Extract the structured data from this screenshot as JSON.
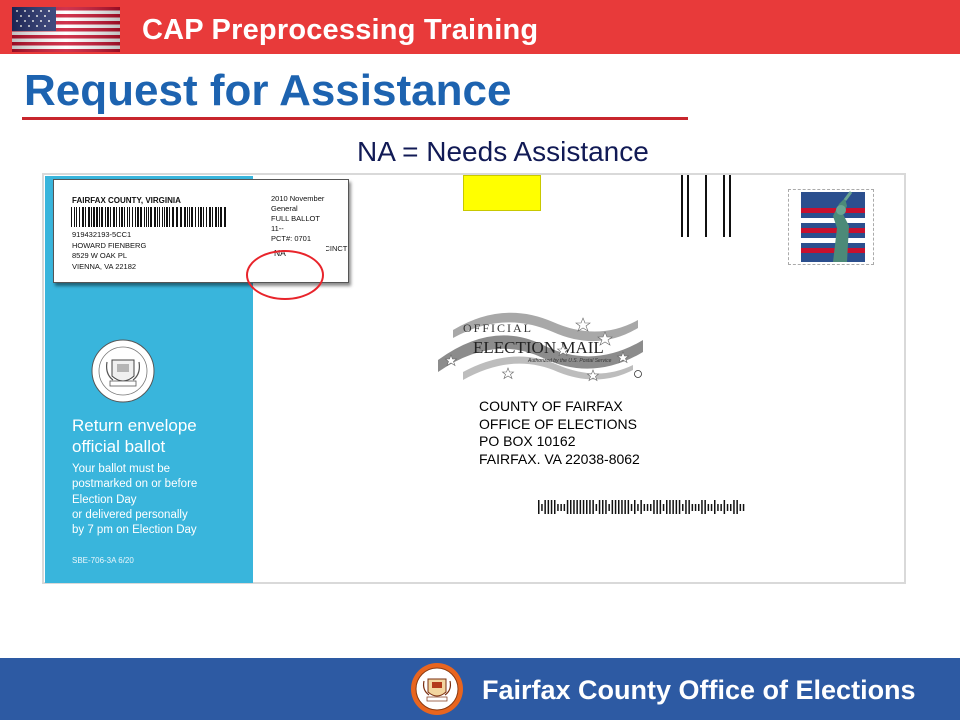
{
  "header": {
    "banner_title": "CAP Preprocessing Training",
    "slide_title": "Request for Assistance",
    "subtitle": "NA = Needs Assistance"
  },
  "envelope": {
    "label": {
      "county": "FAIRFAX COUNTY, VIRGINIA",
      "voter_lines": [
        "919432193-5CC1",
        "HOWARD FIENBERG",
        "8529 W OAK PL",
        "VIENNA, VA  22182"
      ],
      "ballot_lines": [
        "2010 November General",
        "FULL BALLOT",
        "11--",
        "PCT#: 0701",
        "NO TOWN PRECINCT"
      ],
      "na_code": "NA"
    },
    "return_panel": {
      "title_lines": [
        "Return envelope",
        "official ballot"
      ],
      "text_lines": [
        "Your ballot must be",
        "postmarked  on or before",
        "Election Day",
        "or delivered personally",
        "by 7 pm on Election Day"
      ],
      "form_code": "SBE-706-3A 6/20"
    },
    "election_mail": {
      "line1": "OFFICIAL",
      "line2": "ELECTION MAIL",
      "tagline": "Authorized by the U.S. Postal Service"
    },
    "mailing_address": [
      "COUNTY OF FAIRFAX",
      "OFFICE OF ELECTIONS",
      "PO BOX 10162",
      "FAIRFAX. VA 22038-8062"
    ]
  },
  "footer": {
    "org_name": "Fairfax County Office of Elections"
  },
  "colors": {
    "top_banner": "#e83a3a",
    "title_blue": "#1d63b0",
    "envelope_panel": "#39b5dc",
    "bottom_banner": "#2d5aa3",
    "highlight_circle": "#e8242b"
  }
}
